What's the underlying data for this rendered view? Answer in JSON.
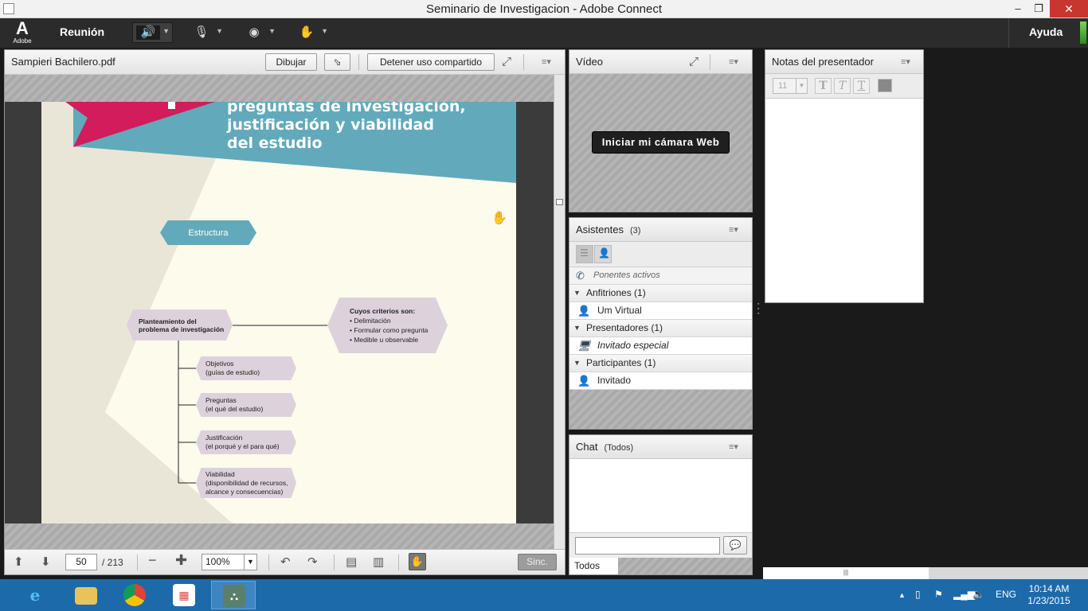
{
  "window": {
    "title": "Seminario de Investigacion - Adobe Connect",
    "minimize": "–",
    "maximize": "❐",
    "close": "✕"
  },
  "menubar": {
    "logo_text": "Adobe",
    "reunion": "Reunión",
    "ayuda": "Ayuda"
  },
  "share": {
    "filename": "Sampieri Bachilero.pdf",
    "dibujar": "Dibujar",
    "detener": "Detener uso compartido",
    "page_current": "50",
    "page_total": "/ 213",
    "zoom": "100%",
    "sinc": "Sinc."
  },
  "document": {
    "title_lines": [
      "preguntas de investigación,",
      "justificación y viabilidad",
      "del estudio"
    ],
    "estructura": "Estructura",
    "planteamiento": [
      "Planteamiento del",
      "problema de investigación"
    ],
    "criterios_title": "Cuyos criterios son:",
    "criterios": [
      "• Delimitación",
      "• Formular como pregunta",
      "• Medible u observable"
    ],
    "items": [
      {
        "l1": "Objetivos",
        "l2": "(guías de estudio)"
      },
      {
        "l1": "Preguntas",
        "l2": "(el qué del estudio)"
      },
      {
        "l1": "Justificación",
        "l2": "(el porqué y el para qué)"
      },
      {
        "l1": "Viabilidad",
        "l2": "(disponibilidad de recursos,",
        "l3": "alcance y consecuencias)"
      }
    ]
  },
  "video": {
    "title": "Vídeo",
    "camera_button": "Iniciar mi cámara Web"
  },
  "attendees": {
    "title": "Asistentes",
    "count": "(3)",
    "active_speakers": "Ponentes activos",
    "groups": [
      {
        "label": "Anfitriones (1)",
        "member": "Um Virtual"
      },
      {
        "label": "Presentadores (1)",
        "member": "Invitado especial"
      },
      {
        "label": "Participantes (1)",
        "member": "Invitado"
      }
    ]
  },
  "chat": {
    "title": "Chat",
    "scope": "(Todos)",
    "tab": "Todos"
  },
  "notes": {
    "title": "Notas del presentador",
    "font_size": "11"
  },
  "taskbar": {
    "lang": "ENG",
    "time": "10:14 AM",
    "date": "1/23/2015"
  }
}
